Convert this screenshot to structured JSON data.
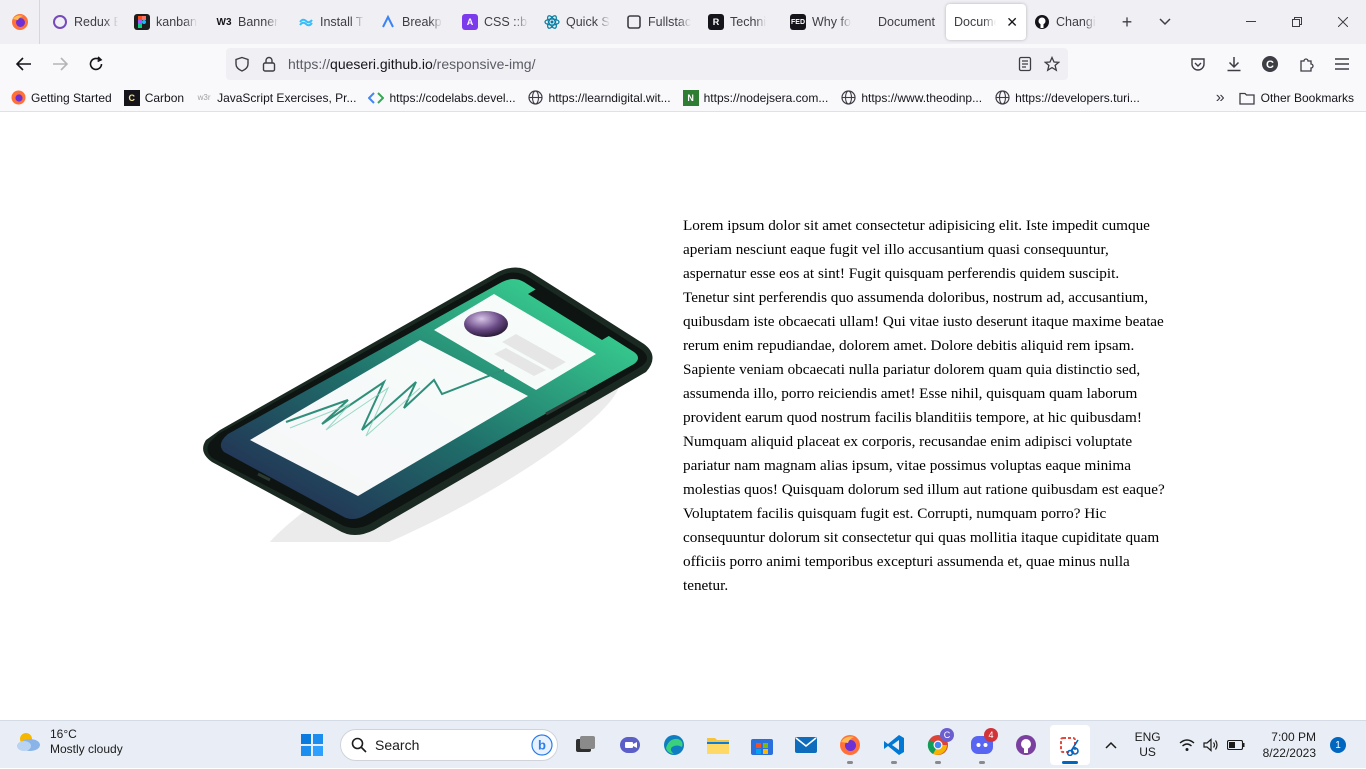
{
  "browser": {
    "tabs": [
      {
        "label": "Redux E",
        "icon": "redux-icon",
        "color": "#764abc"
      },
      {
        "label": "kanban",
        "icon": "figma-icon",
        "color": "#1e1e1e"
      },
      {
        "label": "Banner",
        "icon": "w3schools-icon",
        "color": "#04aa6d"
      },
      {
        "label": "Install T",
        "icon": "tailwind-icon",
        "color": "#38bdf8"
      },
      {
        "label": "Breakp",
        "icon": "tailwind-breakpoints-icon",
        "color": "#3b82f6"
      },
      {
        "label": "CSS ::be",
        "icon": "css-tricks-icon",
        "color": "#7c3aed"
      },
      {
        "label": "Quick S",
        "icon": "react-icon",
        "color": "#087ea4"
      },
      {
        "label": "Fullstac",
        "icon": "fullstack-icon",
        "color": "#3d3d45"
      },
      {
        "label": "Techni",
        "icon": "r-logo-icon",
        "color": "#15141a"
      },
      {
        "label": "Why fo",
        "icon": "fem-icon",
        "color": "#15141a"
      },
      {
        "label": "Document",
        "icon": "",
        "color": ""
      },
      {
        "label": "Docume",
        "icon": "",
        "color": "",
        "active": true
      },
      {
        "label": "Changi",
        "icon": "github-icon",
        "color": "#15141a"
      }
    ],
    "url_prefix": "https://",
    "url_host": "queseri.github.io",
    "url_path": "/responsive-img/",
    "bookmarks": [
      {
        "label": "Getting Started",
        "icon": "firefox-icon"
      },
      {
        "label": "Carbon",
        "icon": "carbon-icon"
      },
      {
        "label": "JavaScript Exercises, Pr...",
        "icon": "w3resource-icon"
      },
      {
        "label": "https://codelabs.devel...",
        "icon": "codelabs-icon"
      },
      {
        "label": "https://learndigital.wit...",
        "icon": "globe-icon"
      },
      {
        "label": "https://nodejsera.com...",
        "icon": "nodejsera-icon"
      },
      {
        "label": "https://www.theodinp...",
        "icon": "globe-icon"
      },
      {
        "label": "https://developers.turi...",
        "icon": "globe-icon"
      }
    ],
    "other_bookmarks": "Other Bookmarks"
  },
  "page": {
    "paragraph": "Lorem ipsum dolor sit amet consectetur adipisicing elit. Iste impedit cumque aperiam nesciunt eaque fugit vel illo accusantium quasi consequuntur, aspernatur esse eos at sint! Fugit quisquam perferendis quidem suscipit. Tenetur sint perferendis quo assumenda doloribus, nostrum ad, accusantium, quibusdam iste obcaecati ullam! Qui vitae iusto deserunt itaque maxime beatae rerum enim repudiandae, dolorem amet. Dolore debitis aliquid rem ipsam. Sapiente veniam obcaecati nulla pariatur dolorem quam quia distinctio sed, assumenda illo, porro reiciendis amet! Esse nihil, quisquam quam laborum provident earum quod nostrum facilis blanditiis tempore, at hic quibusdam! Numquam aliquid placeat ex corporis, recusandae enim adipisci voluptate pariatur nam magnam alias ipsum, vitae possimus voluptas eaque minima molestias quos! Quisquam dolorum sed illum aut ratione quibusdam est eaque? Voluptatem facilis quisquam fugit est. Corrupti, numquam porro? Hic consequuntur dolorum sit consectetur qui quas mollitia itaque cupiditate quam officiis porro animi temporibus excepturi assumenda et, quae minus nulla tenetur."
  },
  "taskbar": {
    "temperature": "16°C",
    "weather": "Mostly cloudy",
    "search_label": "Search",
    "lang_line1": "ENG",
    "lang_line2": "US",
    "time": "7:00 PM",
    "date": "8/22/2023",
    "notifications": "1",
    "chrome_badge": "C",
    "discord_badge": "4"
  },
  "colors": {
    "accent": "#0067c0",
    "phone_green": "#3ee89a",
    "phone_navy": "#23204e"
  }
}
